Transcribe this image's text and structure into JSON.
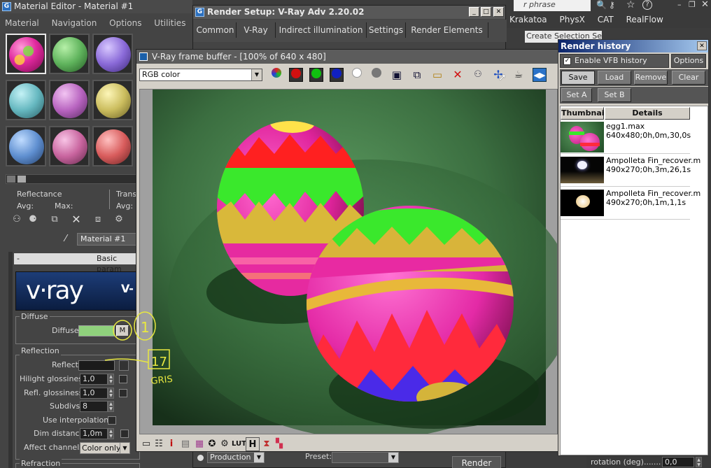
{
  "material_editor": {
    "title": "Material Editor - Material #1",
    "menu": [
      "Material",
      "Navigation",
      "Options",
      "Utilities"
    ],
    "reflectance": "Reflectance",
    "avg1": "Avg:",
    "max1": "Max:",
    "trans": "Trans",
    "avg2": "Avg:",
    "material_name": "Material #1",
    "rollout_toggle": "-",
    "rollout_title": "Basic param",
    "vray_logo": "v·ray",
    "vray_side": "V-",
    "diffuse_group": "Diffuse",
    "diffuse_label": "Diffuse",
    "diffuse_color": "#8fd17c",
    "map_button": "M",
    "reflection_group": "Reflection",
    "reflect_label": "Reflect",
    "hilight_label": "Hilight glossiness",
    "hilight_value": "1,0",
    "refl_label": "Refl. glossiness",
    "refl_value": "1,0",
    "subdivs_label": "Subdivs",
    "subdivs_value": "8",
    "interp_label": "Use interpolation",
    "dim_label": "Dim distance",
    "dim_value": "1,0m",
    "affect_label": "Affect channels",
    "affect_value": "Color only",
    "refraction_group": "Refraction"
  },
  "annotations": {
    "circle_text": "1",
    "box_text": "17",
    "note_text": "GRIS"
  },
  "render_setup": {
    "title": "Render Setup: V-Ray Adv 2.20.02",
    "tabs": [
      "Common",
      "V-Ray",
      "Indirect illumination",
      "Settings",
      "Render Elements"
    ],
    "production": "Production",
    "preset_label": "Preset:",
    "render_button": "Render"
  },
  "max_topbar": {
    "search_hint": "r phrase",
    "menu": [
      "Krakatoa",
      "PhysX",
      "CAT",
      "RealFlow"
    ],
    "selection_set": "Create Selection Se",
    "rotation_label": "rotation (deg).......",
    "rotation_value": "0,0"
  },
  "vfb": {
    "title": "V-Ray frame buffer - [100% of 640 x 480]",
    "channel": "RGB color",
    "icons": [
      "rgb-channels-icon",
      "red-channel-icon",
      "green-channel-icon",
      "blue-channel-icon",
      "alpha-channel-icon",
      "mono-icon",
      "save-image-icon",
      "save-all-icon",
      "load-image-icon",
      "clear-image-icon",
      "region-render-icon",
      "track-mouse-icon",
      "teapot-render-icon",
      "compare-icon"
    ],
    "bottom_icons": [
      "color-corrections-icon",
      "levels-icon",
      "info-icon",
      "curves-icon",
      "exposure-icon",
      "bw-icon",
      "lut-icon",
      "lut-label",
      "histogram-icon",
      "hud-icon",
      "srgb-icon"
    ],
    "lut_text": "LUT",
    "hist_text": "H",
    "info_text": "i"
  },
  "render_history": {
    "title": "Render history",
    "enable_label": "Enable VFB history",
    "options": "Options",
    "buttons": [
      "Save",
      "Load",
      "Remove",
      "Clear"
    ],
    "set_a": "Set A",
    "set_b": "Set B",
    "col_thumb": "Thumbnail",
    "col_details": "Details",
    "rows": [
      {
        "name": "egg1.max",
        "info": "640x480;0h,0m,30,0s"
      },
      {
        "name": "Ampolleta Fin_recover.m",
        "info": "490x270;0h,3m,26,1s"
      },
      {
        "name": "Ampolleta Fin_recover.m",
        "info": "490x270;0h,1m,1,1s"
      }
    ]
  }
}
